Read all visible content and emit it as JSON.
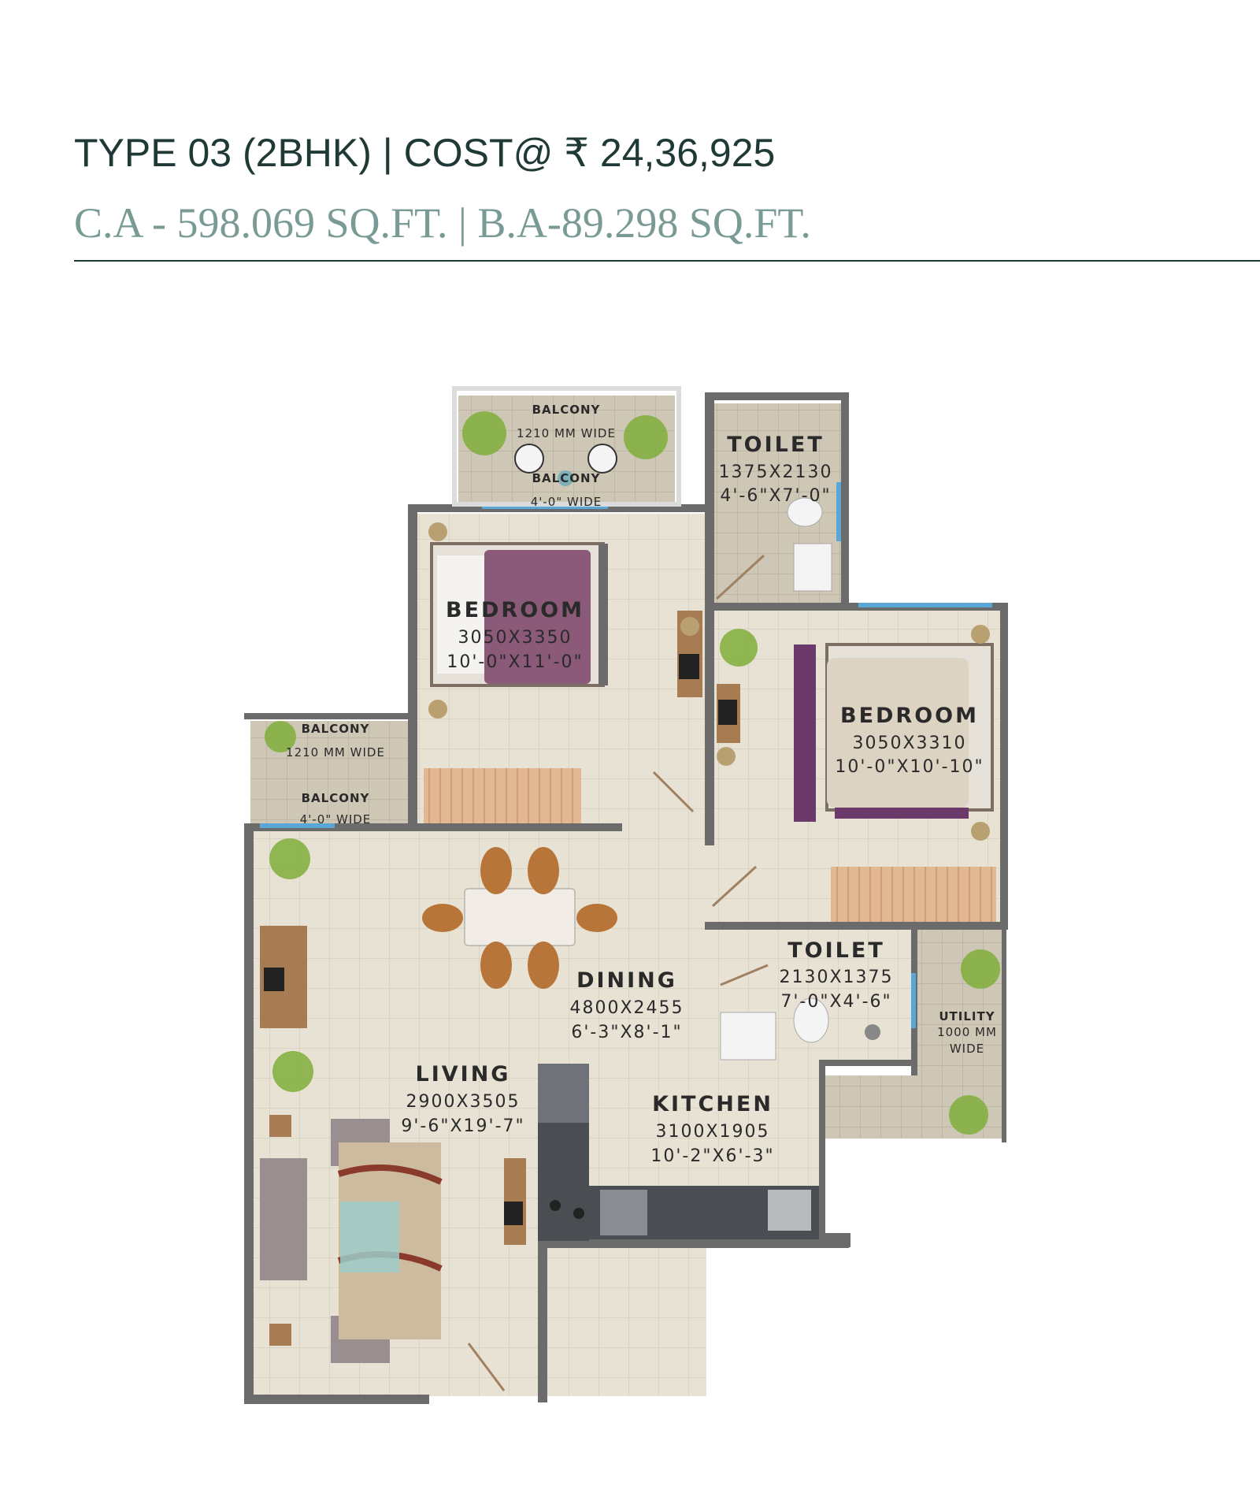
{
  "header": {
    "title": "TYPE 03 (2BHK) | COST@ ₹ 24,36,925",
    "subtitle": "C.A - 598.069 SQ.FT. | B.A-89.298 SQ.FT."
  },
  "plan": {
    "balcony_top": {
      "name": "BALCONY",
      "dim1": "1210 MM WIDE",
      "name2": "BALCONY",
      "dim2": "4'-0\" WIDE"
    },
    "balcony_left": {
      "name": "BALCONY",
      "dim1": "1210 MM WIDE",
      "name2": "BALCONY",
      "dim2": "4'-0\" WIDE"
    },
    "toilet_top": {
      "name": "TOILET",
      "dim_mm": "1375X2130",
      "dim_ft": "4'-6\"X7'-0\""
    },
    "bedroom_1": {
      "name": "BEDROOM",
      "dim_mm": "3050X3350",
      "dim_ft": "10'-0\"X11'-0\""
    },
    "bedroom_2": {
      "name": "BEDROOM",
      "dim_mm": "3050X3310",
      "dim_ft": "10'-0\"X10'-10\""
    },
    "toilet_bottom": {
      "name": "TOILET",
      "dim_mm": "2130X1375",
      "dim_ft": "7'-0\"X4'-6\""
    },
    "utility": {
      "name": "UTILITY",
      "dim1": "1000 MM",
      "dim2": "WIDE"
    },
    "dining": {
      "name": "DINING",
      "dim_mm": "4800X2455",
      "dim_ft": "6'-3\"X8'-1\""
    },
    "living": {
      "name": "LIVING",
      "dim_mm": "2900X3505",
      "dim_ft": "9'-6\"X19'-7\""
    },
    "kitchen": {
      "name": "KITCHEN",
      "dim_mm": "3100X1905",
      "dim_ft": "10'-2\"X6'-3\""
    }
  },
  "colors": {
    "title": "#1f3a36",
    "subtitle": "#7a9a95",
    "floor": "#e8e2d4",
    "wall": "#6b6b6b",
    "window": "#5aa7d6",
    "bedcover": "#8a5a78",
    "wood": "#b07a4a",
    "plant": "#7fae3a"
  }
}
